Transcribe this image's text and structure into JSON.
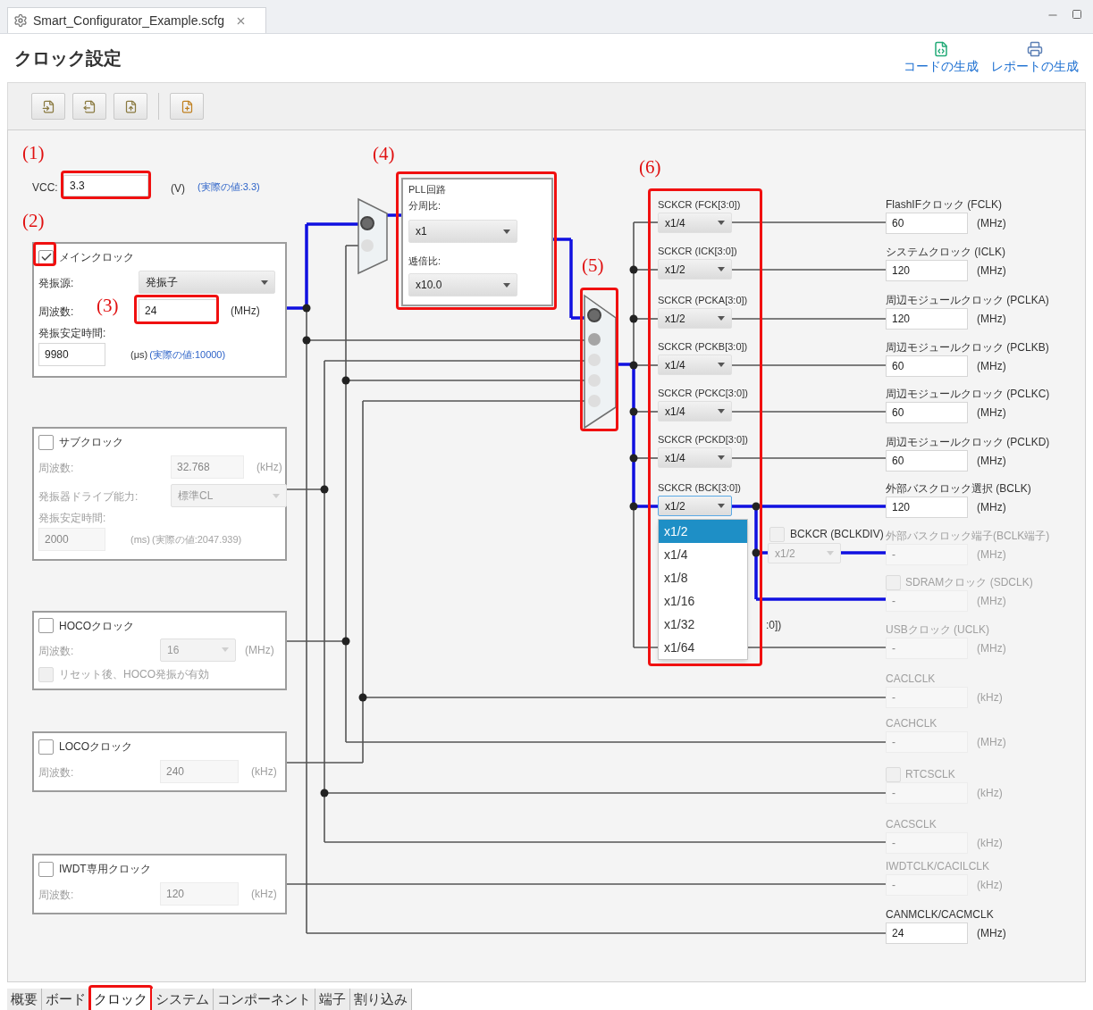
{
  "editor_tab": {
    "title": "Smart_Configurator_Example.scfg"
  },
  "page_title": "クロック設定",
  "actions": [
    {
      "label": "コードの生成"
    },
    {
      "label": "レポートの生成"
    }
  ],
  "annotations": [
    "(1)",
    "(2)",
    "(3)",
    "(4)",
    "(5)",
    "(6)"
  ],
  "vcc": {
    "label": "VCC:",
    "value": "3.3",
    "unit": "(V)",
    "actual": "(実際の値:3.3)"
  },
  "sources": [
    {
      "title": "メインクロック",
      "checked": true,
      "fields": [
        {
          "kind": "select",
          "label": "発振源:",
          "value": "発振子"
        },
        {
          "kind": "input",
          "label": "周波数:",
          "value": "24",
          "unit": "(MHz)"
        },
        {
          "kind": "input_below",
          "label": "発振安定時間:",
          "value": "9980",
          "unit": "(μs)",
          "actual": "(実際の値:10000)"
        }
      ]
    },
    {
      "title": "サブクロック",
      "checked": false,
      "fields": [
        {
          "kind": "input",
          "label": "周波数:",
          "value": "32.768",
          "unit": "(kHz)"
        },
        {
          "kind": "select",
          "label": "発振器ドライブ能力:",
          "value": "標準CL"
        },
        {
          "kind": "input_below",
          "label": "発振安定時間:",
          "value": "2000",
          "unit": "(ms)",
          "actual": "(実際の値:2047.939)"
        }
      ]
    },
    {
      "title": "HOCOクロック",
      "checked": false,
      "fields": [
        {
          "kind": "select",
          "label": "周波数:",
          "value": "16",
          "unit": "(MHz)"
        },
        {
          "kind": "checkbox",
          "label": "リセット後、HOCO発振が有効",
          "checked": false
        }
      ]
    },
    {
      "title": "LOCOクロック",
      "checked": false,
      "fields": [
        {
          "kind": "input",
          "label": "周波数:",
          "value": "240",
          "unit": "(kHz)"
        }
      ]
    },
    {
      "title": "IWDT専用クロック",
      "checked": false,
      "fields": [
        {
          "kind": "input",
          "label": "周波数:",
          "value": "120",
          "unit": "(kHz)"
        }
      ]
    }
  ],
  "pll_mux": {
    "inputs": [
      {
        "selected": true,
        "enabled": true
      },
      {
        "selected": false,
        "enabled": false
      }
    ]
  },
  "pll": {
    "title": "PLL回路",
    "divider": {
      "label": "分周比:",
      "value": "x1"
    },
    "multiplier": {
      "label": "逓倍比:",
      "value": "x10.0"
    }
  },
  "system_mux": {
    "inputs": [
      {
        "selected": true,
        "enabled": true
      },
      {
        "selected": false,
        "enabled": true
      },
      {
        "selected": false,
        "enabled": false
      },
      {
        "selected": false,
        "enabled": false
      },
      {
        "selected": false,
        "enabled": false
      }
    ]
  },
  "dividers": [
    {
      "label": "SCKCR (FCK[3:0])",
      "value": "x1/4",
      "open": false
    },
    {
      "label": "SCKCR (ICK[3:0])",
      "value": "x1/2",
      "open": false
    },
    {
      "label": "SCKCR (PCKA[3:0])",
      "value": "x1/2",
      "open": false
    },
    {
      "label": "SCKCR (PCKB[3:0])",
      "value": "x1/4",
      "open": false
    },
    {
      "label": "SCKCR (PCKC[3:0])",
      "value": "x1/4",
      "open": false
    },
    {
      "label": "SCKCR (PCKD[3:0])",
      "value": "x1/4",
      "open": false
    },
    {
      "label": "SCKCR (BCK[3:0])",
      "value": "x1/2",
      "open": true,
      "options": [
        {
          "label": "x1/2",
          "selected": true
        },
        {
          "label": "x1/4",
          "selected": false
        },
        {
          "label": "x1/8",
          "selected": false
        },
        {
          "label": "x1/16",
          "selected": false
        },
        {
          "label": "x1/32",
          "selected": false
        },
        {
          "label": "x1/64",
          "selected": false
        }
      ]
    }
  ],
  "hidden_divider_label": ":0])",
  "bclk_divider": {
    "label": "BCKCR (BCLKDIV)",
    "checked": false,
    "value": "x1/2"
  },
  "outputs": [
    {
      "label": "FlashIFクロック (FCLK)",
      "value": "60",
      "unit": "(MHz)",
      "enabled": true
    },
    {
      "label": "システムクロック (ICLK)",
      "value": "120",
      "unit": "(MHz)",
      "enabled": true
    },
    {
      "label": "周辺モジュールクロック (PCLKA)",
      "value": "120",
      "unit": "(MHz)",
      "enabled": true
    },
    {
      "label": "周辺モジュールクロック (PCLKB)",
      "value": "60",
      "unit": "(MHz)",
      "enabled": true
    },
    {
      "label": "周辺モジュールクロック (PCLKC)",
      "value": "60",
      "unit": "(MHz)",
      "enabled": true
    },
    {
      "label": "周辺モジュールクロック (PCLKD)",
      "value": "60",
      "unit": "(MHz)",
      "enabled": true
    },
    {
      "label": "外部バスクロック選択 (BCLK)",
      "value": "120",
      "unit": "(MHz)",
      "enabled": true
    },
    {
      "label": "外部バスクロック端子(BCLK端子)",
      "value": "-",
      "unit": "(MHz)",
      "enabled": false
    },
    {
      "label": "SDRAMクロック (SDCLK)",
      "value": "-",
      "unit": "(MHz)",
      "enabled": false,
      "checked": false
    },
    {
      "label": "USBクロック (UCLK)",
      "value": "-",
      "unit": "(MHz)",
      "enabled": false
    },
    {
      "label": "CACLCLK",
      "value": "-",
      "unit": "(kHz)",
      "enabled": false
    },
    {
      "label": "CACHCLK",
      "value": "-",
      "unit": "(MHz)",
      "enabled": false
    },
    {
      "label": "RTCSCLK",
      "value": "-",
      "unit": "(kHz)",
      "enabled": false,
      "checked": false
    },
    {
      "label": "CACSCLK",
      "value": "-",
      "unit": "(kHz)",
      "enabled": false
    },
    {
      "label": "IWDTCLK/CACILCLK",
      "value": "-",
      "unit": "(kHz)",
      "enabled": false
    },
    {
      "label": "CANMCLK/CACMCLK",
      "value": "24",
      "unit": "(MHz)",
      "enabled": true
    }
  ],
  "bottom_tabs": [
    {
      "label": "概要",
      "selected": false
    },
    {
      "label": "ボード",
      "selected": false
    },
    {
      "label": "クロック",
      "selected": true
    },
    {
      "label": "システム",
      "selected": false
    },
    {
      "label": "コンポーネント",
      "selected": false
    },
    {
      "label": "端子",
      "selected": false
    },
    {
      "label": "割り込み",
      "selected": false
    }
  ]
}
